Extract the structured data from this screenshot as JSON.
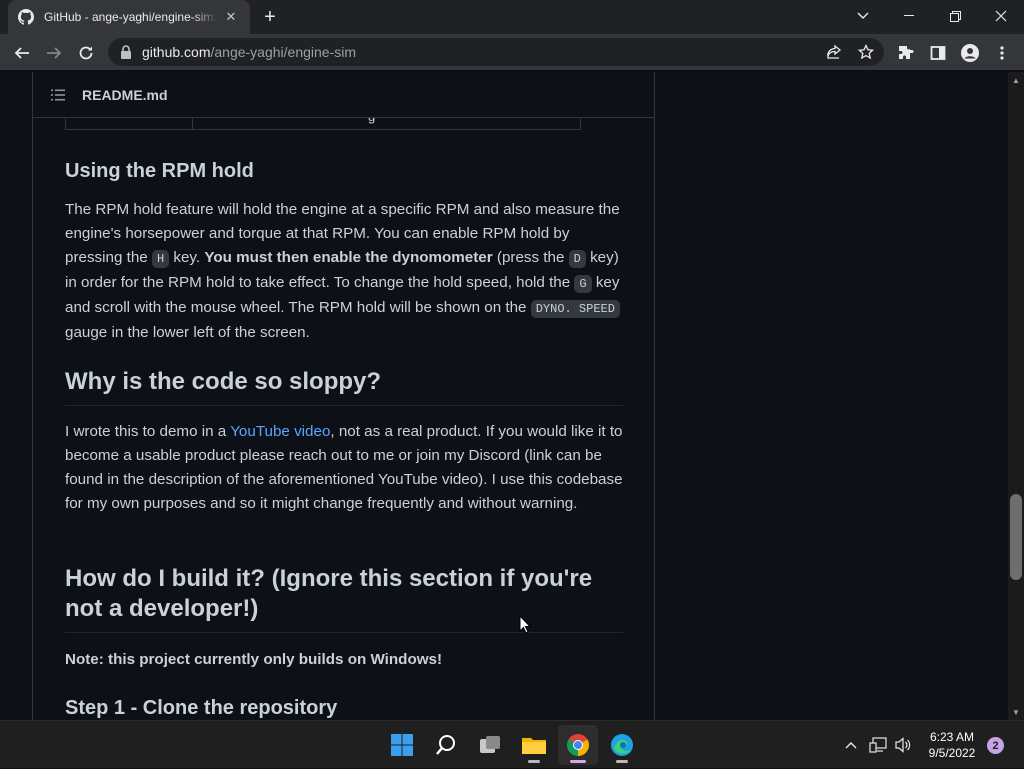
{
  "browser": {
    "tab_title": "GitHub - ange-yaghi/engine-sim: Combustion engine simulator that generates realistic audio.",
    "url_host": "github.com",
    "url_path": "/ange-yaghi/engine-sim"
  },
  "readme": {
    "filename": "README.md",
    "table_fragment": "g"
  },
  "sections": {
    "rpm_hold": {
      "heading": "Using the RPM hold",
      "p1_a": "The RPM hold feature will hold the engine at a specific RPM and also measure the engine's horsepower and torque at that RPM. You can enable RPM hold by pressing the ",
      "key_h": "H",
      "p1_b": " key. ",
      "bold": "You must then enable the dynomometer",
      "p1_c": " (press the ",
      "key_d": "D",
      "p1_d": " key) in order for the RPM hold to take effect. To change the hold speed, hold the ",
      "key_g": "G",
      "p1_e": " key and scroll with the mouse wheel. The RPM hold will be shown on the ",
      "gauge": "DYNO. SPEED",
      "p1_f": " gauge in the lower left of the screen."
    },
    "sloppy": {
      "heading": "Why is the code so sloppy?",
      "p_a": "I wrote this to demo in a ",
      "link": "YouTube video",
      "p_b": ", not as a real product. If you would like it to become a usable product please reach out to me or join my Discord (link can be found in the description of the aforementioned YouTube video). I use this codebase for my own purposes and so it might change frequently and without warning."
    },
    "build": {
      "heading": "How do I build it? (Ignore this section if you're not a developer!)",
      "note": "Note: this project currently only builds on Windows!",
      "step1": "Step 1 - Clone the repository"
    }
  },
  "taskbar": {
    "time": "6:23 AM",
    "date": "9/5/2022",
    "notifications": "2"
  }
}
